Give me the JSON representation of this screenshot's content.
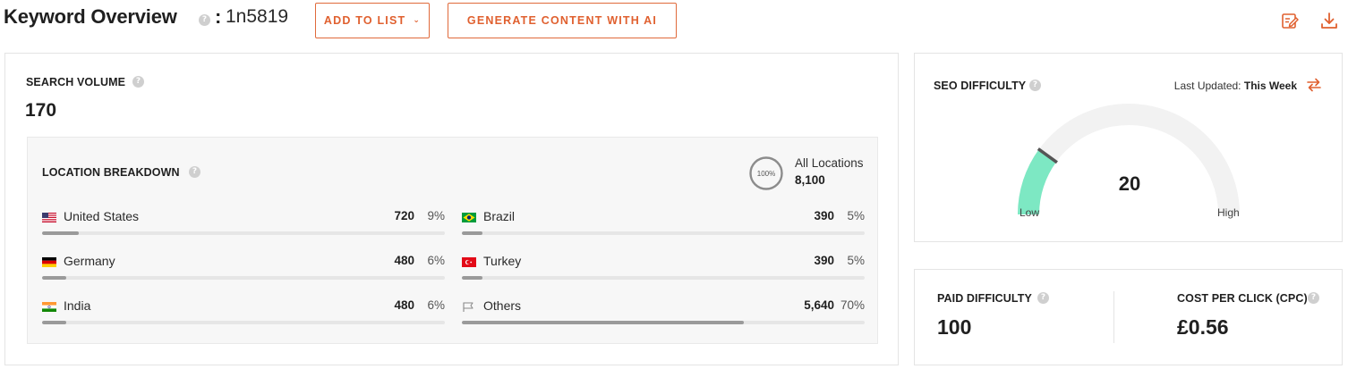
{
  "header": {
    "title": "Keyword Overview",
    "colon": ":",
    "keyword": "1n5819",
    "add_to_list_label": "ADD TO LIST",
    "generate_label": "GENERATE CONTENT WITH AI",
    "accent_color": "#e0602f"
  },
  "search_volume": {
    "label": "SEARCH VOLUME",
    "value": "170"
  },
  "location_breakdown": {
    "label": "LOCATION BREAKDOWN",
    "all_ring_text": "100%",
    "all_label": "All Locations",
    "all_value": "8,100",
    "items": [
      {
        "name": "United States",
        "value": "720",
        "pct": "9%",
        "fraction": 0.09,
        "flag": "us-flag-icon"
      },
      {
        "name": "Germany",
        "value": "480",
        "pct": "6%",
        "fraction": 0.06,
        "flag": "de-flag-icon"
      },
      {
        "name": "India",
        "value": "480",
        "pct": "6%",
        "fraction": 0.06,
        "flag": "in-flag-icon"
      },
      {
        "name": "Brazil",
        "value": "390",
        "pct": "5%",
        "fraction": 0.05,
        "flag": "br-flag-icon"
      },
      {
        "name": "Turkey",
        "value": "390",
        "pct": "5%",
        "fraction": 0.05,
        "flag": "tr-flag-icon"
      },
      {
        "name": "Others",
        "value": "5,640",
        "pct": "70%",
        "fraction": 0.7,
        "flag": "flag-outline-icon"
      }
    ]
  },
  "seo_difficulty": {
    "label": "SEO DIFFICULTY",
    "updated_prefix": "Last Updated:",
    "updated_value": "This Week",
    "value": "20",
    "level": 0.2,
    "low_label": "Low",
    "high_label": "High",
    "gauge_color": "#7de8c3"
  },
  "paid_difficulty": {
    "label": "PAID DIFFICULTY",
    "value": "100"
  },
  "cpc": {
    "label": "COST PER CLICK (CPC)",
    "value": "£0.56"
  }
}
